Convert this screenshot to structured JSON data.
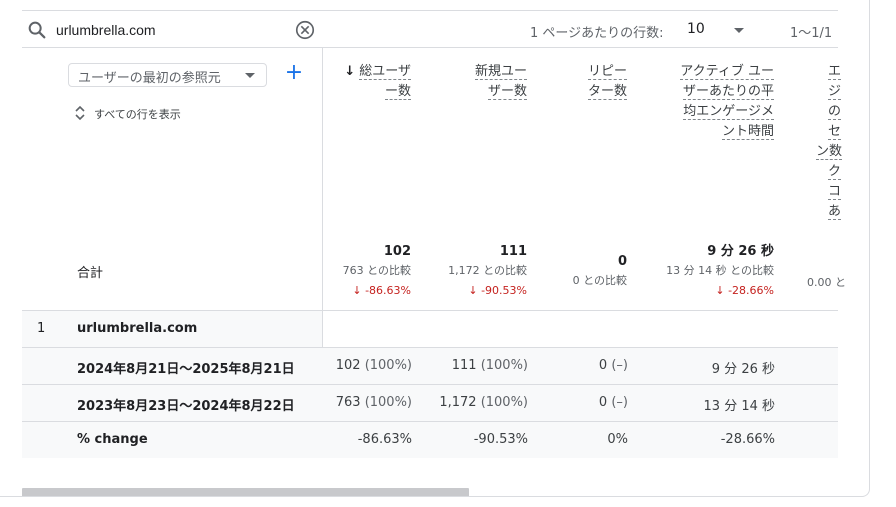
{
  "search": {
    "value": "urlumbrella.com"
  },
  "pagination": {
    "rows_label": "1 ページあたりの行数:",
    "rows_value": "10",
    "range": "1〜1/1"
  },
  "dimension": {
    "label": "ユーザーの最初の参照元",
    "add_symbol": "+",
    "show_all_rows": "すべての行を表示"
  },
  "columns": [
    {
      "title_lines": [
        "総ユーザ",
        "ー数"
      ],
      "sorted": true,
      "sort_arrow": "↓"
    },
    {
      "title_lines": [
        "新規ユー",
        "ザー数"
      ]
    },
    {
      "title_lines": [
        "リピー",
        "ター数"
      ]
    },
    {
      "title_lines": [
        "アクティブ ユー",
        "ザーあたりの平",
        "均エンゲージメ",
        "ント時間"
      ]
    },
    {
      "title_lines": [
        "エ",
        "ジ",
        "の",
        "セ",
        "ン数",
        "ク",
        "コ",
        "あ"
      ]
    }
  ],
  "totals": {
    "label": "合計",
    "cells": [
      {
        "value": "102",
        "compare": "763 との比較",
        "change": "↓ -86.63%"
      },
      {
        "value": "111",
        "compare": "1,172 との比較",
        "change": "↓ -90.53%"
      },
      {
        "value": "0",
        "compare": "0 との比較",
        "change": ""
      },
      {
        "value": "9 分 26 秒",
        "compare": "13 分 14 秒 との比較",
        "change": "↓ -28.66%"
      },
      {
        "value": "",
        "compare": "0.00 と",
        "change": ""
      }
    ]
  },
  "rows": [
    {
      "index": "1",
      "name": "urlumbrella.com",
      "cells": []
    },
    {
      "index": "",
      "name": "2024年8月21日～2025年8月21日",
      "cells": [
        {
          "v": "102",
          "p": "(100%)"
        },
        {
          "v": "111",
          "p": "(100%)"
        },
        {
          "v": "0",
          "p": "(–)"
        },
        {
          "v": "9 分 26 秒",
          "p": ""
        }
      ]
    },
    {
      "index": "",
      "name": "2023年8月23日～2024年8月22日",
      "cells": [
        {
          "v": "763",
          "p": "(100%)"
        },
        {
          "v": "1,172",
          "p": "(100%)"
        },
        {
          "v": "0",
          "p": "(–)"
        },
        {
          "v": "13 分 14 秒",
          "p": ""
        }
      ]
    },
    {
      "index": "",
      "name": "% change",
      "cells": [
        {
          "v": "-86.63%",
          "p": ""
        },
        {
          "v": "-90.53%",
          "p": ""
        },
        {
          "v": "0%",
          "p": ""
        },
        {
          "v": "-28.66%",
          "p": ""
        }
      ]
    }
  ]
}
